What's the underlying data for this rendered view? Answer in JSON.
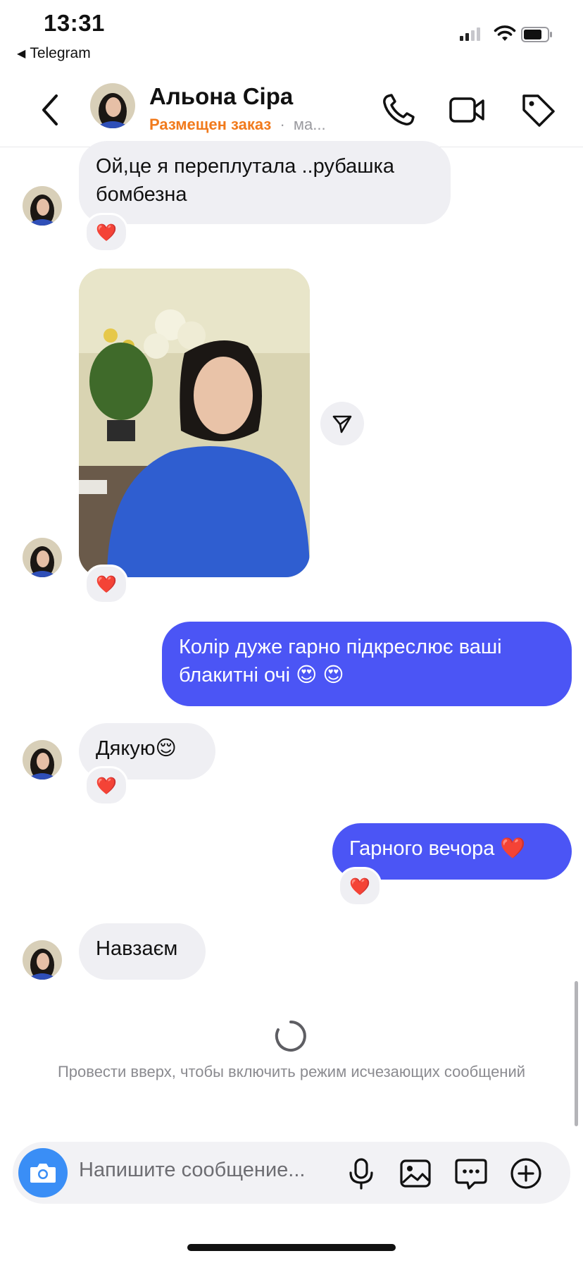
{
  "status_bar": {
    "time": "13:31",
    "back_app": "Telegram"
  },
  "header": {
    "name": "Альона Сіра",
    "status": "Размещен заказ",
    "separator": "·",
    "sub_extra": "ма..."
  },
  "messages": [
    {
      "text": "Ой,це я переплутала ..рубашка бомбезна",
      "reaction": "❤️"
    },
    {
      "reaction": "❤️"
    },
    {
      "text": "Колір дуже гарно підкреслює ваші блакитні очі 😍 😍"
    },
    {
      "text": "Дякую😌",
      "reaction": "❤️"
    },
    {
      "text": "Гарного вечора ❤️",
      "reaction": "❤️"
    },
    {
      "text": "Навзаєм"
    }
  ],
  "hint": "Провести вверх, чтобы включить режим исчезающих сообщений",
  "composer": {
    "placeholder": "Напишите сообщение..."
  },
  "colors": {
    "accent": "#4b55f5",
    "incoming": "#efeff3",
    "status": "#f17a1c",
    "camera": "#3a8ef6"
  }
}
